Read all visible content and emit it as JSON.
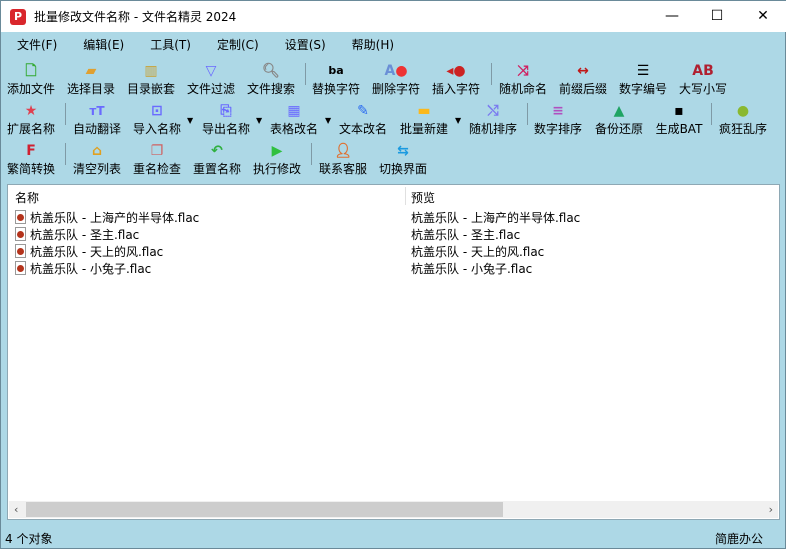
{
  "window": {
    "title": "批量修改文件名称 - 文件名精灵 2024",
    "minimize": "—",
    "maximize": "☐",
    "close": "✕"
  },
  "menu": [
    "文件(F)",
    "编辑(E)",
    "工具(T)",
    "定制(C)",
    "设置(S)",
    "帮助(H)"
  ],
  "toolbar": {
    "row1": [
      "添加文件",
      "选择目录",
      "目录嵌套",
      "文件过滤",
      "文件搜索",
      "替换字符",
      "删除字符",
      "插入字符",
      "随机命名",
      "前缀后缀",
      "数字编号",
      "大写小写"
    ],
    "row2": [
      "扩展名称",
      "自动翻译",
      "导入名称",
      "导出名称",
      "表格改名",
      "文本改名",
      "批量新建",
      "随机排序",
      "数字排序",
      "备份还原",
      "生成BAT",
      "疯狂乱序"
    ],
    "row3": [
      "繁简转换",
      "清空列表",
      "重名检查",
      "重置名称",
      "执行修改",
      "联系客服",
      "切换界面"
    ]
  },
  "list": {
    "columns": [
      "名称",
      "预览"
    ],
    "rows": [
      {
        "name": "杭盖乐队 - 上海产的半导体.flac",
        "preview": "杭盖乐队 - 上海产的半导体.flac"
      },
      {
        "name": "杭盖乐队 - 圣主.flac",
        "preview": "杭盖乐队 - 圣主.flac"
      },
      {
        "name": "杭盖乐队 - 天上的风.flac",
        "preview": "杭盖乐队 - 天上的风.flac"
      },
      {
        "name": "杭盖乐队 - 小兔子.flac",
        "preview": "杭盖乐队 - 小兔子.flac"
      }
    ]
  },
  "status": {
    "count": "4 个对象",
    "brand": "简鹿办公"
  }
}
